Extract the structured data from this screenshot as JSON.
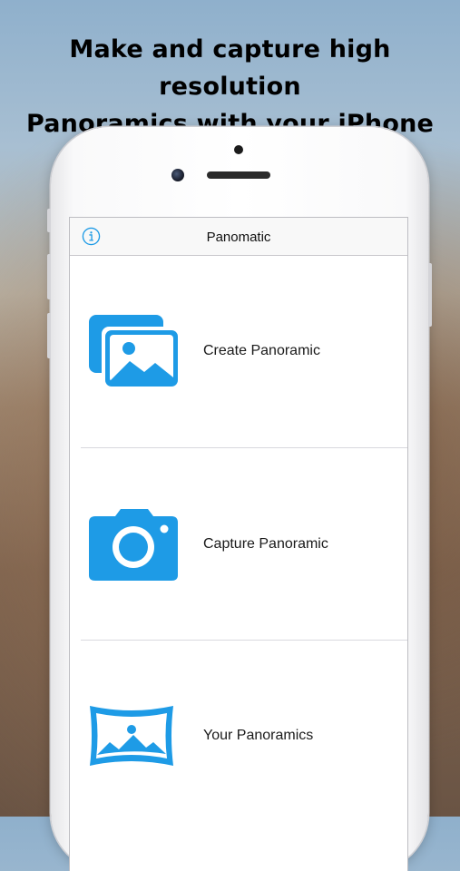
{
  "headline": {
    "line1": "Make and capture high resolution",
    "line2": "Panoramics with your iPhone"
  },
  "app": {
    "title": "Panomatic",
    "info_icon": "info-icon"
  },
  "menu": {
    "items": [
      {
        "label": "Create Panoramic",
        "icon": "photos-stack-icon"
      },
      {
        "label": "Capture Panoramic",
        "icon": "camera-icon"
      },
      {
        "label": "Your Panoramics",
        "icon": "panorama-icon"
      }
    ]
  },
  "colors": {
    "accent": "#1E9BE6",
    "navbar_bg": "#F8F8F8",
    "separator": "#D9D9DE"
  }
}
